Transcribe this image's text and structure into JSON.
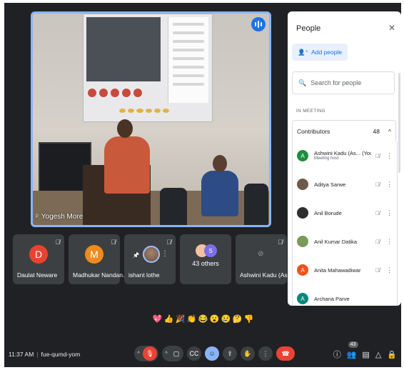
{
  "main_tile": {
    "speaker_name": "Yogesh More"
  },
  "tiles": [
    {
      "initial": "D",
      "color": "#e8432f",
      "name": "Daulat Neware"
    },
    {
      "initial": "M",
      "color": "#f08a1d",
      "name": "Madhukar Nandan..."
    },
    {
      "name": "ishant lothe"
    },
    {
      "others_label": "43 others",
      "stack_initial": "S"
    },
    {
      "name": "Ashwini Kadu (As..."
    }
  ],
  "reactions": [
    "💖",
    "👍",
    "🎉",
    "👏",
    "😂",
    "😮",
    "😢",
    "🤔",
    "👎"
  ],
  "bottom": {
    "time": "11:37 AM",
    "meeting_code": "fue-qumd-yom",
    "people_count": "43"
  },
  "panel": {
    "title": "People",
    "add_label": "Add people",
    "search_placeholder": "Search for people",
    "section_label": "IN MEETING",
    "group_label": "Contributors",
    "group_count": "48",
    "people": [
      {
        "initial": "A",
        "color": "#1e8e3e",
        "name": "Ashwini Kadu (As... (You)",
        "sub": "Meeting host"
      },
      {
        "initial": "A",
        "color": "#6d5a4a",
        "name": "Aditya Sarwe",
        "sub": ""
      },
      {
        "initial": "A",
        "color": "#2e2e2e",
        "name": "Anil Borude",
        "sub": ""
      },
      {
        "initial": "A",
        "color": "#7a9a5a",
        "name": "Anil Kumar Datika",
        "sub": ""
      },
      {
        "initial": "A",
        "color": "#f4511e",
        "name": "Anita Mahawadiwar",
        "sub": ""
      },
      {
        "initial": "A",
        "color": "#00897b",
        "name": "Archana Parve",
        "sub": ""
      }
    ]
  }
}
